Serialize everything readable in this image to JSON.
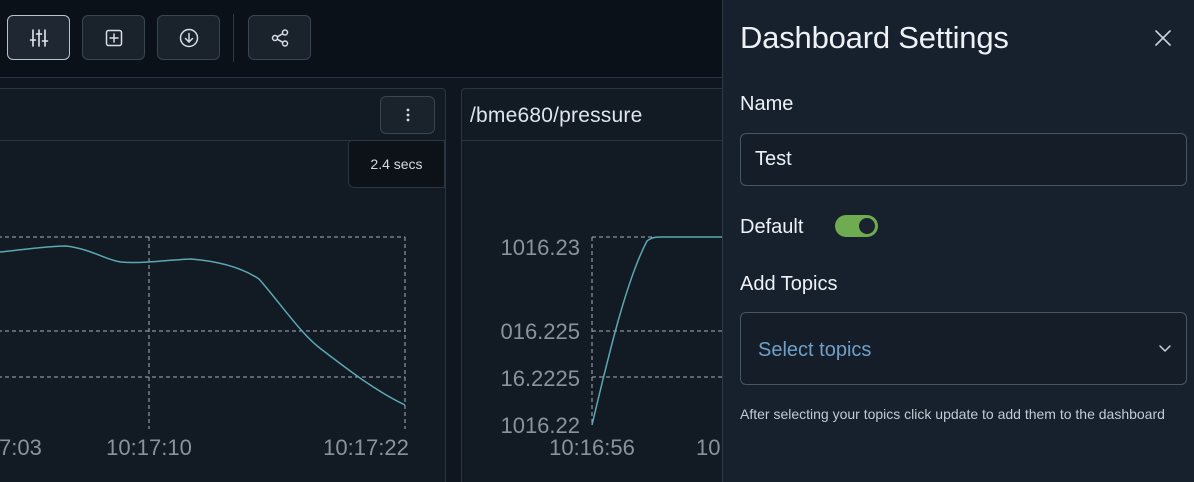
{
  "toolbar": {
    "buttons": [
      {
        "name": "settings-sliders-icon",
        "active": true
      },
      {
        "name": "add-panel-icon",
        "active": false
      },
      {
        "name": "download-icon",
        "active": false
      },
      {
        "name": "share-icon",
        "active": false
      }
    ]
  },
  "panels": [
    {
      "title": "",
      "refresh_badge": "2.4 secs",
      "x_ticks": [
        "7:03",
        "10:17:10",
        "10:17:22"
      ],
      "y_ticks": []
    },
    {
      "title": "/bme680/pressure",
      "x_ticks": [
        "10:16:56",
        "10"
      ],
      "y_ticks": [
        "1016.23",
        "016.225",
        "16.2225",
        "1016.22"
      ]
    }
  ],
  "colors": {
    "series_line": "#5ba8b2",
    "grid": "#a7b0ba",
    "toggle_on": "#6fab50",
    "placeholder": "#6fa0c8"
  },
  "drawer": {
    "title": "Dashboard Settings",
    "name_label": "Name",
    "name_value": "Test",
    "default_label": "Default",
    "default_on": true,
    "topics_label": "Add Topics",
    "topics_placeholder": "Select topics",
    "help_text": "After selecting your topics click update to add them to the dashboard"
  }
}
